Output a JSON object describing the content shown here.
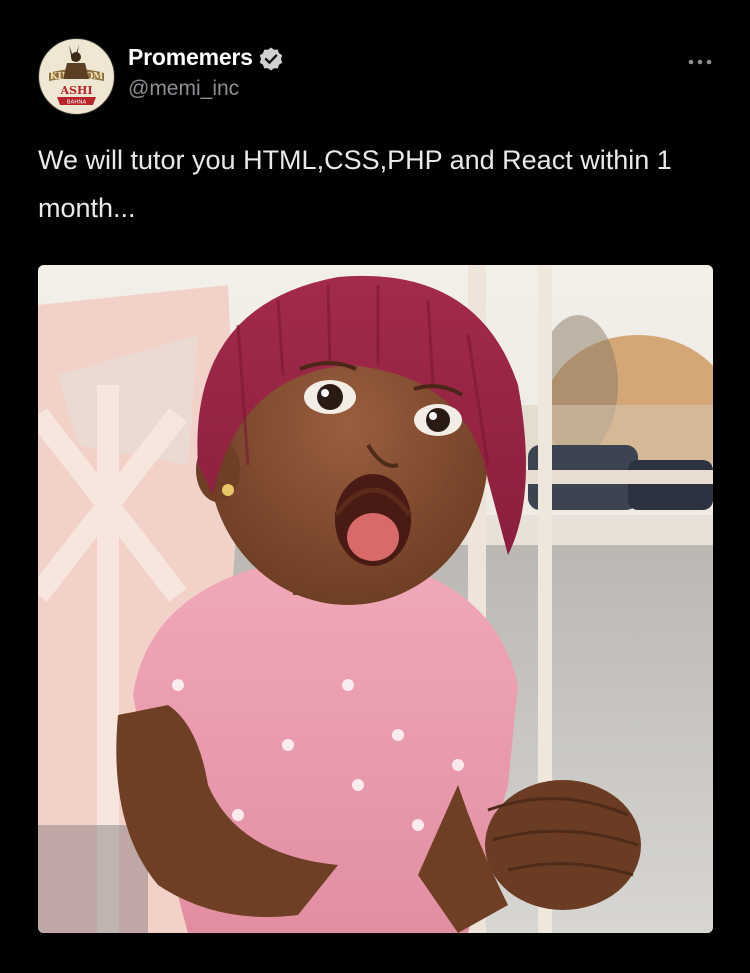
{
  "post": {
    "author": {
      "display_name": "Promemers",
      "handle": "@memi_inc",
      "verified": true,
      "avatar_icon": "kingdom-ashi-logo-avatar"
    },
    "more_icon": "more-options-icon",
    "text": "We will tutor you HTML,CSS,PHP and React within 1 month...",
    "media": {
      "type": "photo",
      "alt_icon": "surprised-baby-photo"
    }
  },
  "colors": {
    "background": "#000000",
    "text_primary": "#e7e9ea",
    "text_secondary": "#8b8f93",
    "verified_badge": "#d0d0d0"
  }
}
